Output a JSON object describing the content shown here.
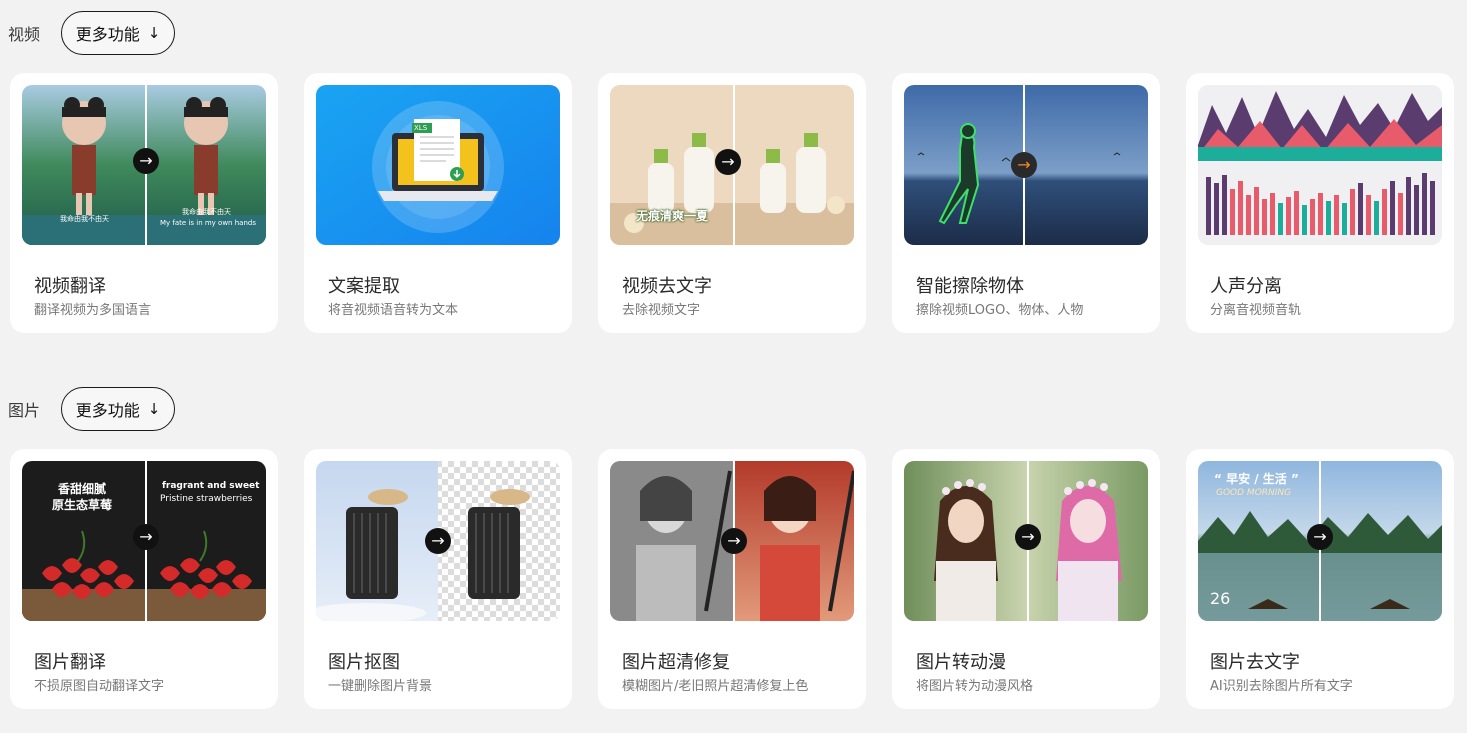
{
  "sections": [
    {
      "title": "视频",
      "more_label": "更多功能",
      "cards": [
        {
          "title": "视频翻译",
          "desc": "翻译视频为多国语言",
          "overlay_left": "我命由我不由天",
          "overlay_right_cn": "我命由我不由天",
          "overlay_right_en": "My fate is in my own hands"
        },
        {
          "title": "文案提取",
          "desc": "将音视频语音转为文本",
          "badge": "XLS"
        },
        {
          "title": "视频去文字",
          "desc": "去除视频文字",
          "overlay_left": "无痕清爽一夏"
        },
        {
          "title": "智能擦除物体",
          "desc": "擦除视频LOGO、物体、人物"
        },
        {
          "title": "人声分离",
          "desc": "分离音视频音轨"
        }
      ]
    },
    {
      "title": "图片",
      "more_label": "更多功能",
      "cards": [
        {
          "title": "图片翻译",
          "desc": "不损原图自动翻译文字",
          "overlay_left_1": "香甜细腻",
          "overlay_left_2": "原生态草莓",
          "overlay_right_1": "fragrant and sweet",
          "overlay_right_2": "Pristine strawberries"
        },
        {
          "title": "图片抠图",
          "desc": "一键删除图片背景"
        },
        {
          "title": "图片超清修复",
          "desc": "模糊图片/老旧照片超清修复上色"
        },
        {
          "title": "图片转动漫",
          "desc": "将图片转为动漫风格"
        },
        {
          "title": "图片去文字",
          "desc": "AI识别去除图片所有文字",
          "overlay_title": "“ 早安 / 生活 ”",
          "overlay_sub": "GOOD MORNING",
          "overlay_date": "26"
        }
      ]
    }
  ],
  "icons": {
    "arrow_down": "arrow-down-icon",
    "arrow_right": "arrow-right-icon"
  }
}
